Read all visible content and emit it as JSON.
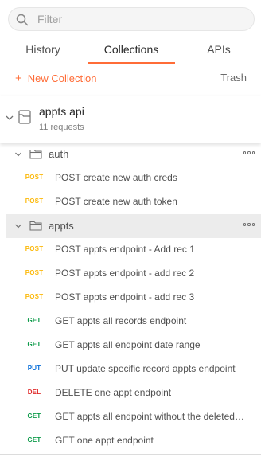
{
  "search": {
    "placeholder": "Filter",
    "value": ""
  },
  "tabs": [
    {
      "label": "History",
      "active": false
    },
    {
      "label": "Collections",
      "active": true
    },
    {
      "label": "APIs",
      "active": false
    }
  ],
  "actions": {
    "new_collection_label": "New Collection",
    "trash_label": "Trash"
  },
  "collection": {
    "name": "appts api",
    "request_count": "11 requests",
    "expanded": true
  },
  "folders": [
    {
      "name": "auth",
      "expanded": true,
      "selected": false,
      "requests": [
        {
          "method": "POST",
          "name": "POST create new auth creds"
        },
        {
          "method": "POST",
          "name": "POST create new auth token"
        }
      ]
    },
    {
      "name": "appts",
      "expanded": true,
      "selected": true,
      "requests": [
        {
          "method": "POST",
          "name": "POST appts endpoint - Add rec 1"
        },
        {
          "method": "POST",
          "name": "POST appts endpoint - add rec 2"
        },
        {
          "method": "POST",
          "name": "POST appts endpoint - add rec 3"
        },
        {
          "method": "GET",
          "name": "GET appts all records endpoint"
        },
        {
          "method": "GET",
          "name": "GET appts all endpoint date range"
        },
        {
          "method": "PUT",
          "name": "PUT update specific record appts endpoint"
        },
        {
          "method": "DEL",
          "name": "DELETE one appt endpoint"
        },
        {
          "method": "GET",
          "name": "GET appts all endpoint without the deleted record"
        },
        {
          "method": "GET",
          "name": "GET one appt endpoint"
        }
      ]
    }
  ],
  "colors": {
    "accent": "#ff6c37",
    "post": "#fcb90b",
    "get": "#0d9b4a",
    "put": "#0a6fd9",
    "del": "#e02b2b"
  },
  "icons": {
    "search": "search-icon",
    "collection_chevron": "chevron-down-icon",
    "collection": "collection-icon",
    "folder": "folder-icon",
    "more": "more-horizontal-icon"
  }
}
